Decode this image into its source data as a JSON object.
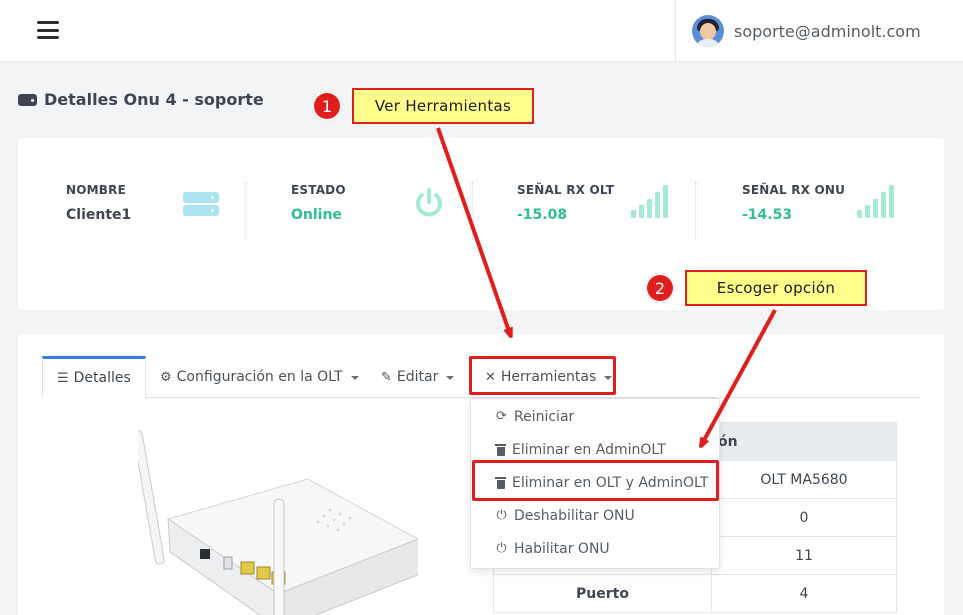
{
  "header": {
    "user_email": "soporte@adminolt.com"
  },
  "page": {
    "title": "Detalles Onu 4 - soporte"
  },
  "stats": [
    {
      "label": "NOMBRE",
      "value": "Cliente1",
      "icon": "server-icon"
    },
    {
      "label": "ESTADO",
      "value": "Online",
      "icon": "power-icon"
    },
    {
      "label": "SEÑAL RX OLT",
      "value": "-15.08",
      "icon": "signal-bars-icon"
    },
    {
      "label": "SEÑAL RX ONU",
      "value": "-14.53",
      "icon": "signal-bars-icon"
    }
  ],
  "tabs": {
    "detalles": "Detalles",
    "configuracion": "Configuración en la OLT",
    "editar": "Editar",
    "herramientas": "Herramientas"
  },
  "dropdown": {
    "items": [
      {
        "label": "Reiniciar",
        "icon": "refresh-icon"
      },
      {
        "label": "Eliminar en AdminOLT",
        "icon": "trash-icon"
      },
      {
        "label": "Eliminar en OLT y AdminOLT",
        "icon": "trash-icon"
      },
      {
        "label": "Deshabilitar ONU",
        "icon": "power-icon"
      },
      {
        "label": "Habilitar ONU",
        "icon": "power-icon"
      }
    ]
  },
  "table": {
    "header_partial": "ón",
    "rows": [
      {
        "key": "",
        "value": "OLT MA5680"
      },
      {
        "key": "",
        "value": "0"
      },
      {
        "key": "",
        "value": "11"
      },
      {
        "key": "Puerto",
        "value": "4"
      }
    ]
  },
  "annotations": {
    "step1_number": "1",
    "step1_label": "Ver Herramientas",
    "step2_number": "2",
    "step2_label": "Escoger opción"
  },
  "colors": {
    "accent_red": "#e01e1e",
    "callout_yellow": "#fefe8a",
    "status_green": "#2ec08e",
    "tab_active_blue": "#3b7ddd"
  }
}
